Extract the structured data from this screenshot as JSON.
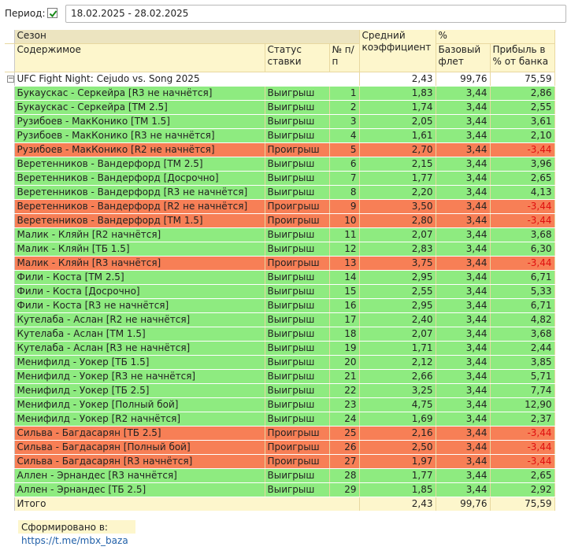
{
  "toolbar": {
    "period_label": "Период:",
    "period_checked": true,
    "period_value": "18.02.2025 - 28.02.2025"
  },
  "header": {
    "season": "Сезон",
    "content": "Содержимое",
    "status": "Статус ставки",
    "num": "№ п/п",
    "avg_coef": "Средний коэффициент",
    "pct": "%",
    "base_flat": "Базовый флет",
    "profit": "Прибыль в % от банка"
  },
  "group": {
    "name": "UFC Fight Night: Cejudo vs. Song 2025",
    "avg": "2,43",
    "base": "99,76",
    "profit": "75,59"
  },
  "rows": [
    {
      "name": "Букаускас - Серкейра [R3 не начнётся]",
      "status": "Выигрыш",
      "n": "1",
      "coef": "1,83",
      "base": "3,44",
      "profit": "2,86",
      "win": true
    },
    {
      "name": "Букаускас - Серкейра [ТМ 2.5]",
      "status": "Выигрыш",
      "n": "2",
      "coef": "1,74",
      "base": "3,44",
      "profit": "2,55",
      "win": true
    },
    {
      "name": "Рузибоев - МакКонико [ТМ 1.5]",
      "status": "Выигрыш",
      "n": "3",
      "coef": "2,05",
      "base": "3,44",
      "profit": "3,61",
      "win": true
    },
    {
      "name": "Рузибоев - МакКонико [R3 не начнётся]",
      "status": "Выигрыш",
      "n": "4",
      "coef": "1,61",
      "base": "3,44",
      "profit": "2,10",
      "win": true
    },
    {
      "name": "Рузибоев - МакКонико [R2 не начнётся]",
      "status": "Проигрыш",
      "n": "5",
      "coef": "2,70",
      "base": "3,44",
      "profit": "-3,44",
      "win": false
    },
    {
      "name": "Веретенников - Вандерфорд [ТМ 2.5]",
      "status": "Выигрыш",
      "n": "6",
      "coef": "2,15",
      "base": "3,44",
      "profit": "3,96",
      "win": true
    },
    {
      "name": "Веретенников - Вандерфорд [Досрочно]",
      "status": "Выигрыш",
      "n": "7",
      "coef": "1,77",
      "base": "3,44",
      "profit": "2,65",
      "win": true
    },
    {
      "name": "Веретенников - Вандерфорд [R3 не начнётся]",
      "status": "Выигрыш",
      "n": "8",
      "coef": "2,20",
      "base": "3,44",
      "profit": "4,13",
      "win": true
    },
    {
      "name": "Веретенников - Вандерфорд [R2 не начнётся]",
      "status": "Проигрыш",
      "n": "9",
      "coef": "3,50",
      "base": "3,44",
      "profit": "-3,44",
      "win": false
    },
    {
      "name": "Веретенников - Вандерфорд [ТМ 1.5]",
      "status": "Проигрыш",
      "n": "10",
      "coef": "2,80",
      "base": "3,44",
      "profit": "-3,44",
      "win": false
    },
    {
      "name": "Малик - Кляйн [R2 начнётся]",
      "status": "Выигрыш",
      "n": "11",
      "coef": "2,07",
      "base": "3,44",
      "profit": "3,68",
      "win": true
    },
    {
      "name": "Малик - Кляйн [ТБ 1.5]",
      "status": "Выигрыш",
      "n": "12",
      "coef": "2,83",
      "base": "3,44",
      "profit": "6,30",
      "win": true
    },
    {
      "name": "Малик - Кляйн [R3 начнётся]",
      "status": "Проигрыш",
      "n": "13",
      "coef": "3,75",
      "base": "3,44",
      "profit": "-3,44",
      "win": false
    },
    {
      "name": "Фили - Коста [ТМ 2.5]",
      "status": "Выигрыш",
      "n": "14",
      "coef": "2,95",
      "base": "3,44",
      "profit": "6,71",
      "win": true
    },
    {
      "name": "Фили - Коста [Досрочно]",
      "status": "Выигрыш",
      "n": "15",
      "coef": "2,55",
      "base": "3,44",
      "profit": "5,33",
      "win": true
    },
    {
      "name": "Фили - Коста [R3 не начнётся]",
      "status": "Выигрыш",
      "n": "16",
      "coef": "2,95",
      "base": "3,44",
      "profit": "6,71",
      "win": true
    },
    {
      "name": "Кутелаба - Аслан [R2 не начнётся]",
      "status": "Выигрыш",
      "n": "17",
      "coef": "2,40",
      "base": "3,44",
      "profit": "4,82",
      "win": true
    },
    {
      "name": "Кутелаба - Аслан [ТМ 1.5]",
      "status": "Выигрыш",
      "n": "18",
      "coef": "2,07",
      "base": "3,44",
      "profit": "3,68",
      "win": true
    },
    {
      "name": "Кутелаба - Аслан [R3 не начнётся]",
      "status": "Выигрыш",
      "n": "19",
      "coef": "1,71",
      "base": "3,44",
      "profit": "2,44",
      "win": true
    },
    {
      "name": "Менифилд - Уокер [ТБ 1.5]",
      "status": "Выигрыш",
      "n": "20",
      "coef": "2,12",
      "base": "3,44",
      "profit": "3,85",
      "win": true
    },
    {
      "name": "Менифилд - Уокер [R3 не начнётся]",
      "status": "Выигрыш",
      "n": "21",
      "coef": "2,66",
      "base": "3,44",
      "profit": "5,71",
      "win": true
    },
    {
      "name": "Менифилд - Уокер [ТБ 2.5]",
      "status": "Выигрыш",
      "n": "22",
      "coef": "3,25",
      "base": "3,44",
      "profit": "7,74",
      "win": true
    },
    {
      "name": "Менифилд - Уокер [Полный бой]",
      "status": "Выигрыш",
      "n": "23",
      "coef": "4,75",
      "base": "3,44",
      "profit": "12,90",
      "win": true
    },
    {
      "name": "Менифилд - Уокер [R2 начнётся]",
      "status": "Выигрыш",
      "n": "24",
      "coef": "1,69",
      "base": "3,44",
      "profit": "2,37",
      "win": true
    },
    {
      "name": "Сильва - Багдасарян [ТБ 2.5]",
      "status": "Проигрыш",
      "n": "25",
      "coef": "2,16",
      "base": "3,44",
      "profit": "-3,44",
      "win": false
    },
    {
      "name": "Сильва - Багдасарян [Полный бой]",
      "status": "Проигрыш",
      "n": "26",
      "coef": "2,50",
      "base": "3,44",
      "profit": "-3,44",
      "win": false
    },
    {
      "name": "Сильва - Багдасарян [R3 начнётся]",
      "status": "Проигрыш",
      "n": "27",
      "coef": "1,97",
      "base": "3,44",
      "profit": "-3,44",
      "win": false
    },
    {
      "name": "Аллен - Эрнандес [R3 начнётся]",
      "status": "Выигрыш",
      "n": "28",
      "coef": "1,77",
      "base": "3,44",
      "profit": "2,65",
      "win": true
    },
    {
      "name": "Аллен - Эрнандес [ТБ 2.5]",
      "status": "Выигрыш",
      "n": "29",
      "coef": "1,85",
      "base": "3,44",
      "profit": "2,92",
      "win": true
    }
  ],
  "total": {
    "label": "Итого",
    "avg": "2,43",
    "base": "99,76",
    "profit": "75,59"
  },
  "footer": {
    "label": "Сформировано в:",
    "link": "https://t.me/mbx_baza"
  },
  "colors": {
    "win": "#8eeb80",
    "loss": "#f77f56",
    "header": "#fdf6cc",
    "negative": "#e01010"
  }
}
